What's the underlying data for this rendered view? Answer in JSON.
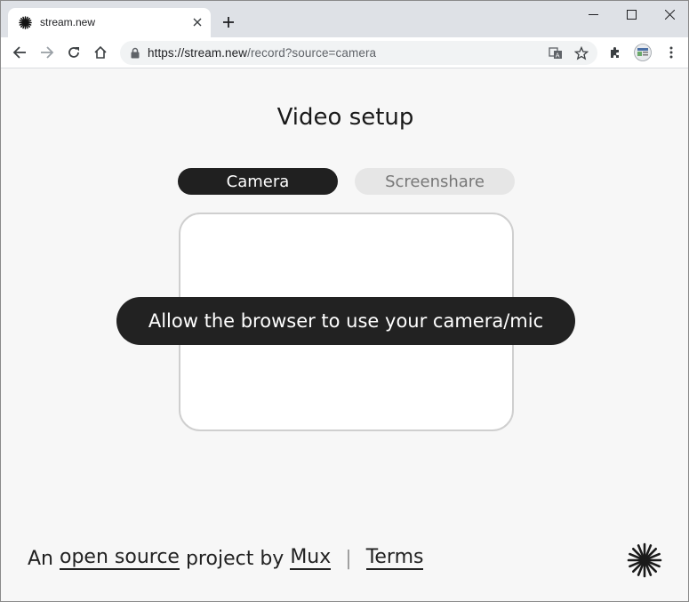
{
  "browser": {
    "tab": {
      "title": "stream.new"
    },
    "url": {
      "host": "https://stream.new",
      "path": "/record?source=camera"
    }
  },
  "page": {
    "title": "Video setup",
    "tabs": [
      {
        "label": "Camera",
        "active": true
      },
      {
        "label": "Screenshare",
        "active": false
      }
    ],
    "permission_prompt": "Allow the browser to use your camera/mic",
    "footer": {
      "prefix": "An",
      "open_source_link": "open source",
      "middle": "project by",
      "mux_link": "Mux",
      "separator": "|",
      "terms_link": "Terms"
    }
  },
  "colors": {
    "active_tab_bg": "#202020",
    "inactive_tab_bg": "#e6e6e6",
    "prompt_bg": "#222222",
    "page_bg": "#f7f7f7"
  },
  "icons": [
    "mux-logo-icon",
    "close-icon",
    "plus-icon",
    "back-icon",
    "forward-icon",
    "reload-icon",
    "home-icon",
    "lock-icon",
    "translate-icon",
    "star-icon",
    "extensions-icon",
    "profile-icon",
    "menu-icon"
  ]
}
